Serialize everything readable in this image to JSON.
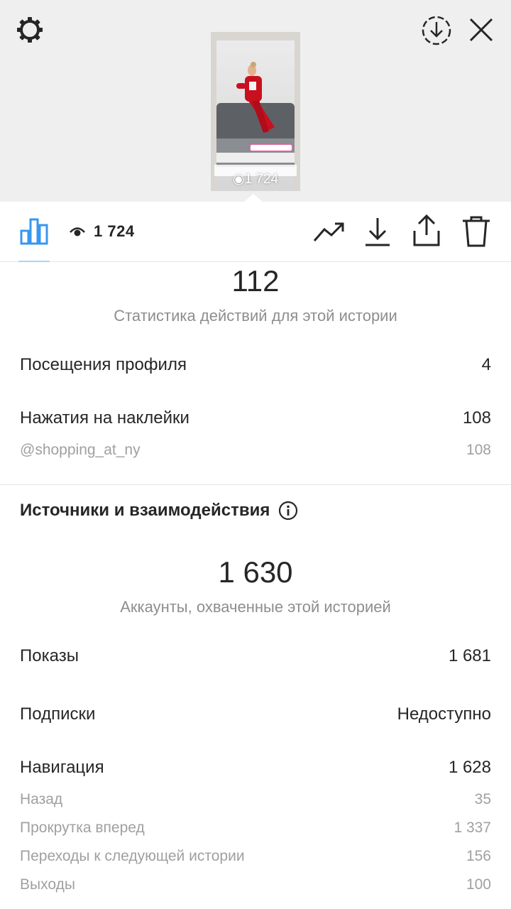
{
  "header": {
    "settings_icon": "gear-icon",
    "save_icon": "download-circle-icon",
    "close_icon": "close-icon"
  },
  "story_preview": {
    "views_label": "1 724"
  },
  "toolbar": {
    "insights_icon": "bar-chart-icon",
    "views_count": "1 724",
    "promote_icon": "trend-arrow-icon",
    "save_icon": "download-icon",
    "share_icon": "share-icon",
    "delete_icon": "trash-icon",
    "accent_color": "#3897f0"
  },
  "interactions": {
    "total": "112",
    "caption": "Статистика действий для этой истории",
    "rows": [
      {
        "label": "Посещения профиля",
        "value": "4"
      },
      {
        "label": "Нажатия на наклейки",
        "value": "108"
      }
    ],
    "sticker_sub": {
      "label": "@shopping_at_ny",
      "value": "108"
    }
  },
  "discovery": {
    "title": "Источники и взаимодействия",
    "info_icon": "info-icon",
    "total": "1 630",
    "caption": "Аккаунты, охваченные этой историей",
    "rows": [
      {
        "label": "Показы",
        "value": "1 681"
      },
      {
        "label": "Подписки",
        "value": "Недоступно"
      },
      {
        "label": "Навигация",
        "value": "1 628"
      }
    ],
    "navigation_sub": [
      {
        "label": "Назад",
        "value": "35"
      },
      {
        "label": "Прокрутка вперед",
        "value": "1 337"
      },
      {
        "label": "Переходы к следующей истории",
        "value": "156"
      },
      {
        "label": "Выходы",
        "value": "100"
      }
    ]
  }
}
